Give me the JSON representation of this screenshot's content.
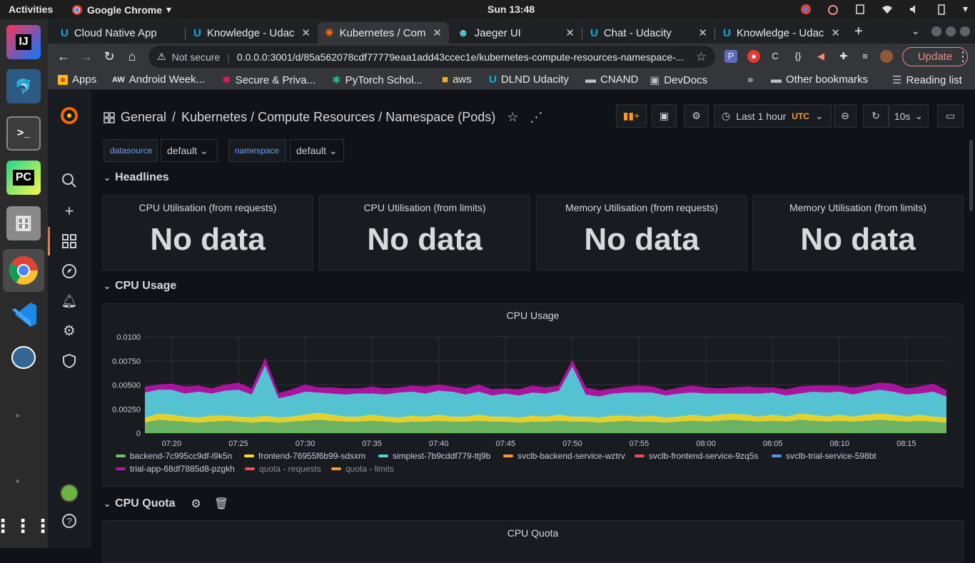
{
  "desktop": {
    "activities": "Activities",
    "app_name": "Google Chrome",
    "clock": "Sun 13:48"
  },
  "chrome": {
    "tabs": [
      {
        "title": "Cloud Native App"
      },
      {
        "title": "Knowledge - Udac"
      },
      {
        "title": "Kubernetes / Com"
      },
      {
        "title": "Jaeger UI"
      },
      {
        "title": "Chat - Udacity"
      },
      {
        "title": "Knowledge - Udac"
      }
    ],
    "security": "Not secure",
    "url": "0.0.0.0:3001/d/85a562078cdf77779eaa1add43ccec1e/kubernetes-compute-resources-namespace-...",
    "update_label": "Update",
    "bookmarks": [
      "Apps",
      "Android Week...",
      "Secure & Priva...",
      "PyTorch Schol...",
      "aws",
      "DLND Udacity",
      "CNAND",
      "DevDocs"
    ],
    "other_bookmarks": "Other bookmarks",
    "reading_list": "Reading list",
    "more": "»"
  },
  "grafana": {
    "breadcrumb": {
      "folder": "General",
      "sep": "/",
      "dashboard": "Kubernetes / Compute Resources / Namespace (Pods)"
    },
    "time_range": "Last 1 hour",
    "timezone": "UTC",
    "refresh": "10s",
    "variables": [
      {
        "label": "datasource",
        "value": "default"
      },
      {
        "label": "namespace",
        "value": "default"
      }
    ],
    "rows": {
      "headlines": "Headlines",
      "cpu_usage": "CPU Usage",
      "cpu_quota": "CPU Quota"
    },
    "stat_panels": [
      {
        "title": "CPU Utilisation (from requests)",
        "value": "No data"
      },
      {
        "title": "CPU Utilisation (from limits)",
        "value": "No data"
      },
      {
        "title": "Memory Utilisation (from requests)",
        "value": "No data"
      },
      {
        "title": "Memory Utilisation (from limits)",
        "value": "No data"
      }
    ],
    "quota_panel_title": "CPU Quota"
  },
  "chart_data": {
    "type": "area",
    "title": "CPU Usage",
    "stacked": true,
    "ylim": [
      0,
      0.01
    ],
    "yticks": [
      "0",
      "0.00250",
      "0.00500",
      "0.00750",
      "0.0100"
    ],
    "xticks": [
      "07:20",
      "07:25",
      "07:30",
      "07:35",
      "07:40",
      "07:45",
      "07:50",
      "07:55",
      "08:00",
      "08:05",
      "08:10",
      "08:15"
    ],
    "x_start": "07:18",
    "x_end": "08:18",
    "legend_position": "bottom",
    "series": [
      {
        "name": "backend-7c995cc9df-l9k5n",
        "color": "#73bf69",
        "values": [
          0.0011,
          0.0014,
          0.0013,
          0.0012,
          0.0011,
          0.0012,
          0.0013,
          0.0012,
          0.0011,
          0.0012,
          0.0011,
          0.0012,
          0.0013,
          0.0014,
          0.0013,
          0.0012,
          0.0012,
          0.0013,
          0.0012,
          0.0011,
          0.0012,
          0.0012,
          0.0013,
          0.0012,
          0.0012,
          0.0013,
          0.0012,
          0.0012,
          0.0011,
          0.0012,
          0.0012,
          0.0013,
          0.0012,
          0.0012,
          0.0011,
          0.0012,
          0.0013,
          0.0012,
          0.0012,
          0.0011,
          0.0012,
          0.0013,
          0.0012,
          0.0013,
          0.0014,
          0.0013,
          0.0012,
          0.0013,
          0.0012,
          0.0014,
          0.0013,
          0.0012,
          0.0013,
          0.0012,
          0.0013,
          0.0014,
          0.0013,
          0.0012,
          0.0013,
          0.0012,
          0.0011
        ]
      },
      {
        "name": "frontend-76955f6b99-sdsxm",
        "color": "#fade2a",
        "values": [
          0.0005,
          0.0006,
          0.0006,
          0.0005,
          0.0005,
          0.0006,
          0.0005,
          0.0005,
          0.0005,
          0.0006,
          0.0005,
          0.0005,
          0.0006,
          0.0007,
          0.0006,
          0.0005,
          0.0005,
          0.0006,
          0.0005,
          0.0005,
          0.0006,
          0.0005,
          0.0006,
          0.0005,
          0.0005,
          0.0006,
          0.0005,
          0.0005,
          0.0005,
          0.0006,
          0.0005,
          0.0006,
          0.0005,
          0.0005,
          0.0005,
          0.0006,
          0.0005,
          0.0005,
          0.0006,
          0.0005,
          0.0005,
          0.0006,
          0.0005,
          0.0006,
          0.0006,
          0.0006,
          0.0005,
          0.0006,
          0.0005,
          0.0006,
          0.0006,
          0.0005,
          0.0006,
          0.0005,
          0.0006,
          0.0006,
          0.0006,
          0.0005,
          0.0006,
          0.0005,
          0.0005
        ]
      },
      {
        "name": "simplest-7b9cddf779-ttj9b",
        "color": "#5ad0e0",
        "values": [
          0.0026,
          0.0025,
          0.0026,
          0.0024,
          0.0027,
          0.0023,
          0.0026,
          0.0028,
          0.0024,
          0.0052,
          0.002,
          0.0022,
          0.0024,
          0.0021,
          0.0022,
          0.0023,
          0.0024,
          0.0022,
          0.0023,
          0.0026,
          0.0025,
          0.0024,
          0.0025,
          0.0026,
          0.0023,
          0.0024,
          0.0022,
          0.0024,
          0.0023,
          0.0024,
          0.0024,
          0.0025,
          0.0052,
          0.0023,
          0.0022,
          0.0023,
          0.0024,
          0.0025,
          0.0024,
          0.0023,
          0.0024,
          0.0023,
          0.0024,
          0.0022,
          0.0021,
          0.0022,
          0.0024,
          0.0023,
          0.0022,
          0.0021,
          0.0024,
          0.0025,
          0.0024,
          0.0023,
          0.0024,
          0.0025,
          0.0024,
          0.0023,
          0.0022,
          0.0026,
          0.0022
        ]
      },
      {
        "name": "svclb-backend-service-wztrv",
        "color": "#ff9830",
        "values": []
      },
      {
        "name": "svclb-frontend-service-9zq5s",
        "color": "#f2495c",
        "values": []
      },
      {
        "name": "svclb-trial-service-598bt",
        "color": "#5794f2",
        "values": []
      },
      {
        "name": "trial-app-68df7885d8-pzgkh",
        "color": "#b613a8",
        "values": [
          0.0006,
          0.0005,
          0.0006,
          0.0007,
          0.0006,
          0.0005,
          0.0006,
          0.0007,
          0.0006,
          0.0007,
          0.0005,
          0.0006,
          0.0007,
          0.0005,
          0.0006,
          0.0006,
          0.0005,
          0.0007,
          0.0006,
          0.0005,
          0.0006,
          0.0007,
          0.0006,
          0.0005,
          0.0006,
          0.0007,
          0.0006,
          0.0005,
          0.0006,
          0.0007,
          0.0006,
          0.0005,
          0.0006,
          0.0007,
          0.0006,
          0.0005,
          0.0006,
          0.0007,
          0.0006,
          0.0005,
          0.0006,
          0.0007,
          0.0006,
          0.0005,
          0.0006,
          0.0007,
          0.0006,
          0.0005,
          0.0006,
          0.0007,
          0.0006,
          0.0007,
          0.0006,
          0.0007,
          0.0006,
          0.0007,
          0.0008,
          0.0006,
          0.0007,
          0.0008,
          0.0006
        ]
      },
      {
        "name": "quota - requests",
        "color": "#f2495c",
        "values": [],
        "dim": true
      },
      {
        "name": "quota - limits",
        "color": "#ff9830",
        "values": [],
        "dim": true
      }
    ]
  }
}
